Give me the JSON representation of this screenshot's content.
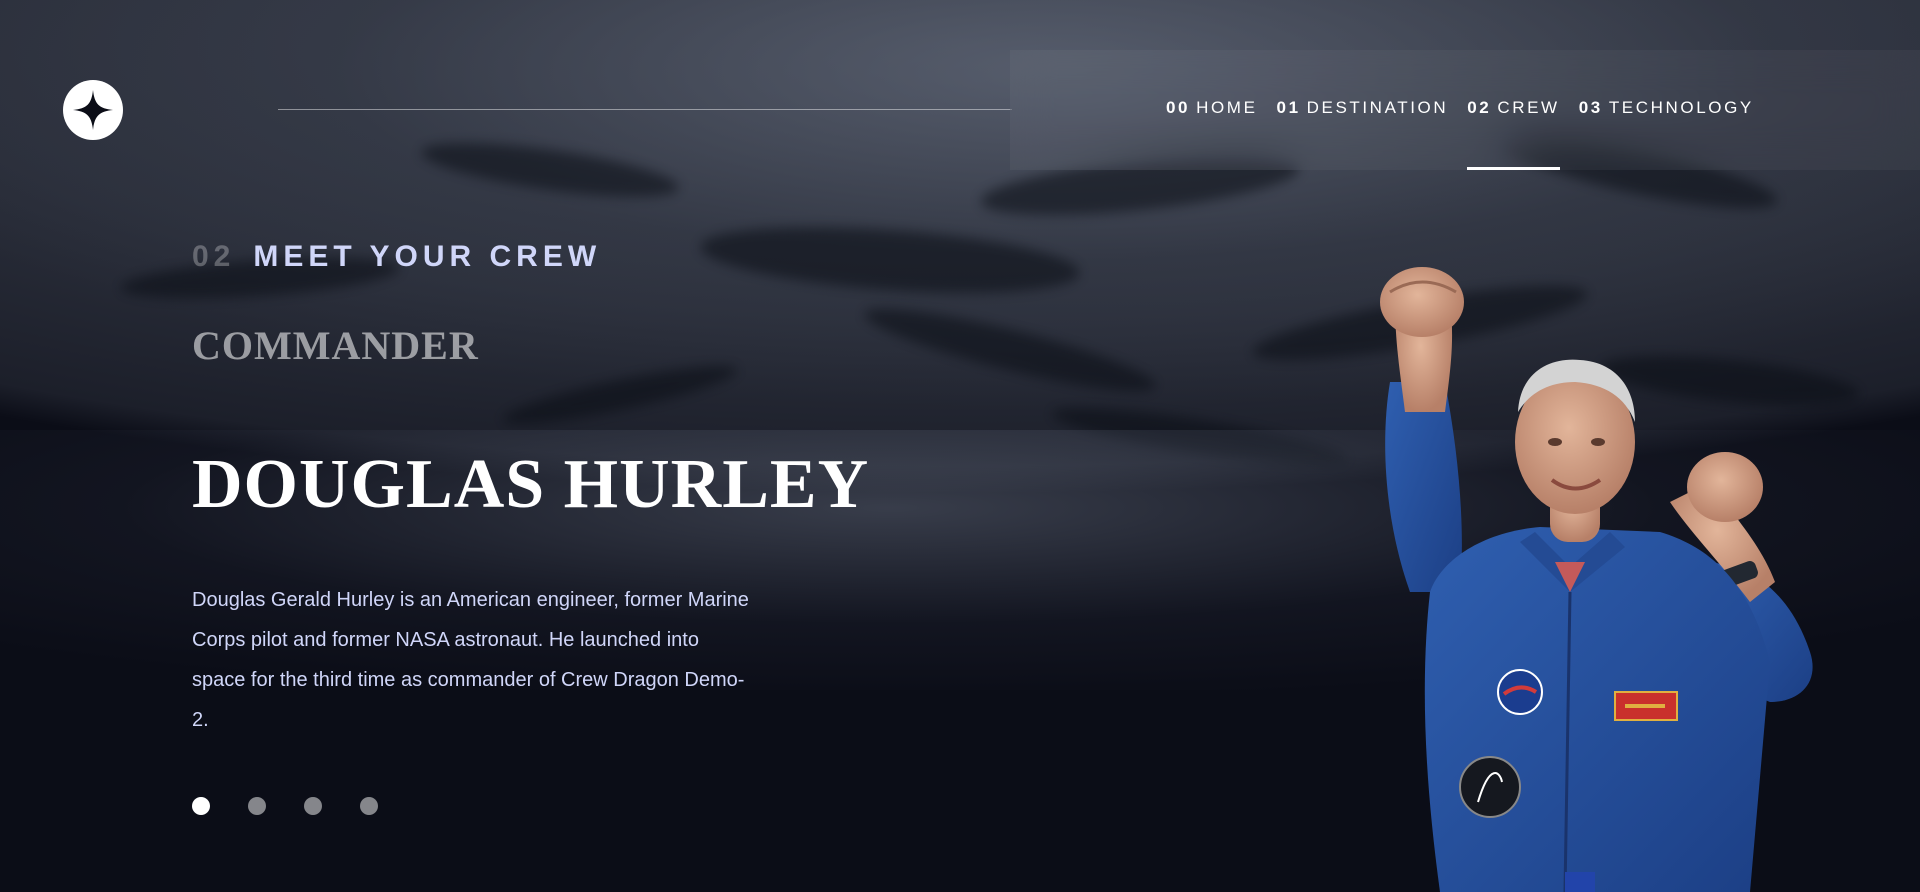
{
  "nav": {
    "items": [
      {
        "num": "00",
        "label": "HOME",
        "active": false
      },
      {
        "num": "01",
        "label": "DESTINATION",
        "active": false
      },
      {
        "num": "02",
        "label": "CREW",
        "active": true
      },
      {
        "num": "03",
        "label": "TECHNOLOGY",
        "active": false
      }
    ]
  },
  "crew": {
    "eyebrow_num": "02",
    "eyebrow_label": "MEET YOUR CREW",
    "role": "COMMANDER",
    "name": "DOUGLAS HURLEY",
    "bio": "Douglas Gerald Hurley is an American engineer, former Marine Corps pilot and former NASA astronaut. He launched into space for the third time as commander of Crew Dragon Demo-2.",
    "slides_count": 4,
    "active_slide": 1
  },
  "icons": {
    "logo": "star-logo-icon"
  },
  "colors": {
    "background": "#0b0d17",
    "accent_text": "#d0d6f9",
    "white": "#ffffff"
  }
}
